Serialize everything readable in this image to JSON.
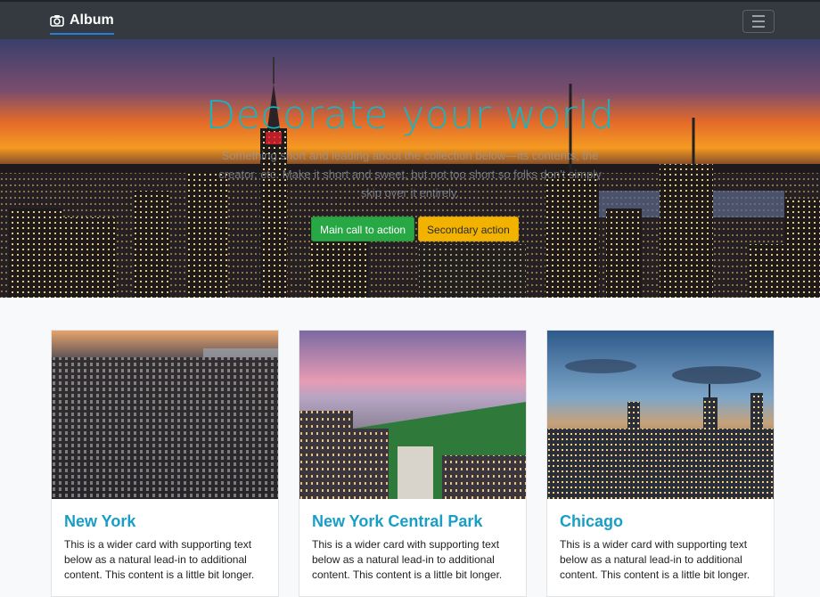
{
  "navbar": {
    "brand": "Album",
    "brand_icon": "camera-icon",
    "toggler_icon": "hamburger-menu-icon"
  },
  "hero": {
    "title": "Decorate your world",
    "lead": "Something short and leading about the collection below—its contents, the creator, etc. Make it short and sweet, but not too short so folks don't simply skip over it entirely.",
    "primary_button": "Main call to action",
    "secondary_button": "Secondary action",
    "title_color": "#1bb3bf",
    "primary_color": "#28a745",
    "secondary_color": "#f2b300"
  },
  "cards": [
    {
      "title": "New York",
      "text": "This is a wider card with supporting text below as a natural lead-in to additional content. This content is a little bit longer."
    },
    {
      "title": "New York Central Park",
      "text": "This is a wider card with supporting text below as a natural lead-in to additional content. This content is a little bit longer."
    },
    {
      "title": "Chicago",
      "text": "This is a wider card with supporting text below as a natural lead-in to additional content. This content is a little bit longer."
    }
  ]
}
